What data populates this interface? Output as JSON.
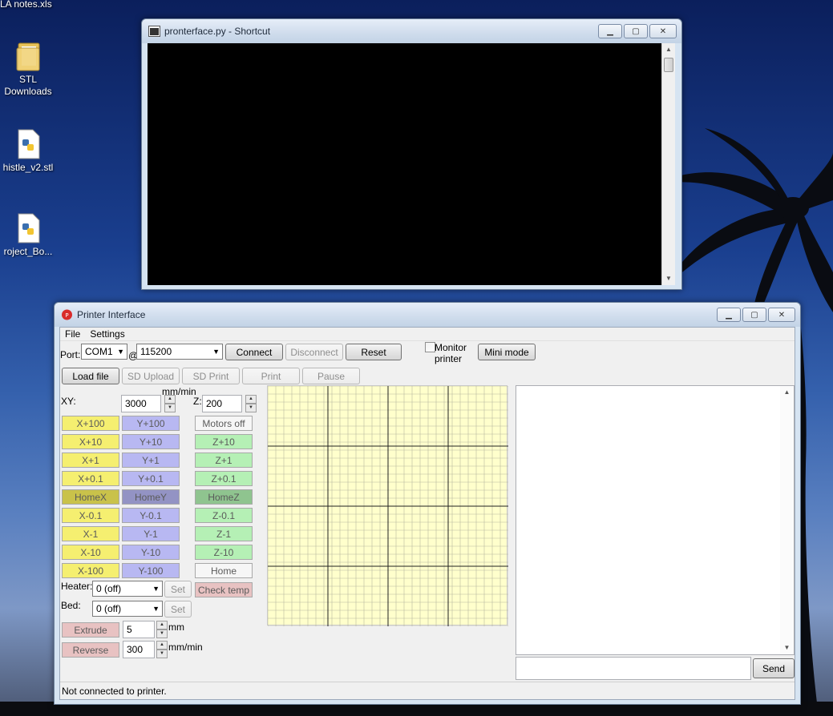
{
  "desktop": {
    "icons": [
      {
        "label": "LA notes.xls",
        "icon": "spreadsheet-icon"
      },
      {
        "label": "STL",
        "label2": "Downloads",
        "icon": "folder-icon"
      },
      {
        "label": "histle_v2.stl",
        "icon": "python-file-icon"
      },
      {
        "label": "roject_Bo...",
        "icon": "python-file-icon"
      }
    ]
  },
  "shortcut_window": {
    "title": "pronterface.py - Shortcut"
  },
  "printer_window": {
    "title": "Printer Interface",
    "menu": [
      "File",
      "Settings"
    ],
    "port_label": "Port:",
    "port_value": "COM1",
    "at_sign": "@",
    "baud_value": "115200",
    "connect": "Connect",
    "disconnect": "Disconnect",
    "reset": "Reset",
    "monitor_label": "Monitor",
    "monitor_label2": "printer",
    "mini_mode": "Mini mode",
    "load_file": "Load file",
    "sd_upload": "SD Upload",
    "sd_print": "SD Print",
    "print": "Print",
    "pause": "Pause",
    "mm_min_label": "mm/min",
    "xy_label": "XY:",
    "xy_value": "3000",
    "z_label": "Z:",
    "z_value": "200",
    "x_buttons": [
      "X+100",
      "X+10",
      "X+1",
      "X+0.1",
      "HomeX",
      "X-0.1",
      "X-1",
      "X-10",
      "X-100"
    ],
    "y_buttons": [
      "Y+100",
      "Y+10",
      "Y+1",
      "Y+0.1",
      "HomeY",
      "Y-0.1",
      "Y-1",
      "Y-10",
      "Y-100"
    ],
    "z_buttons": [
      "Motors off",
      "Z+10",
      "Z+1",
      "Z+0.1",
      "HomeZ",
      "Z-0.1",
      "Z-1",
      "Z-10",
      "Home"
    ],
    "heater_label": "Heater:",
    "heater_value": "0 (off)",
    "heater_set": "Set",
    "check_temp": "Check temp",
    "bed_label": "Bed:",
    "bed_value": "0 (off)",
    "bed_set": "Set",
    "extrude": "Extrude",
    "extrude_value": "5",
    "extrude_unit": "mm",
    "reverse": "Reverse",
    "reverse_value": "300",
    "reverse_unit": "mm/min",
    "send": "Send",
    "status": "Not connected to printer."
  }
}
